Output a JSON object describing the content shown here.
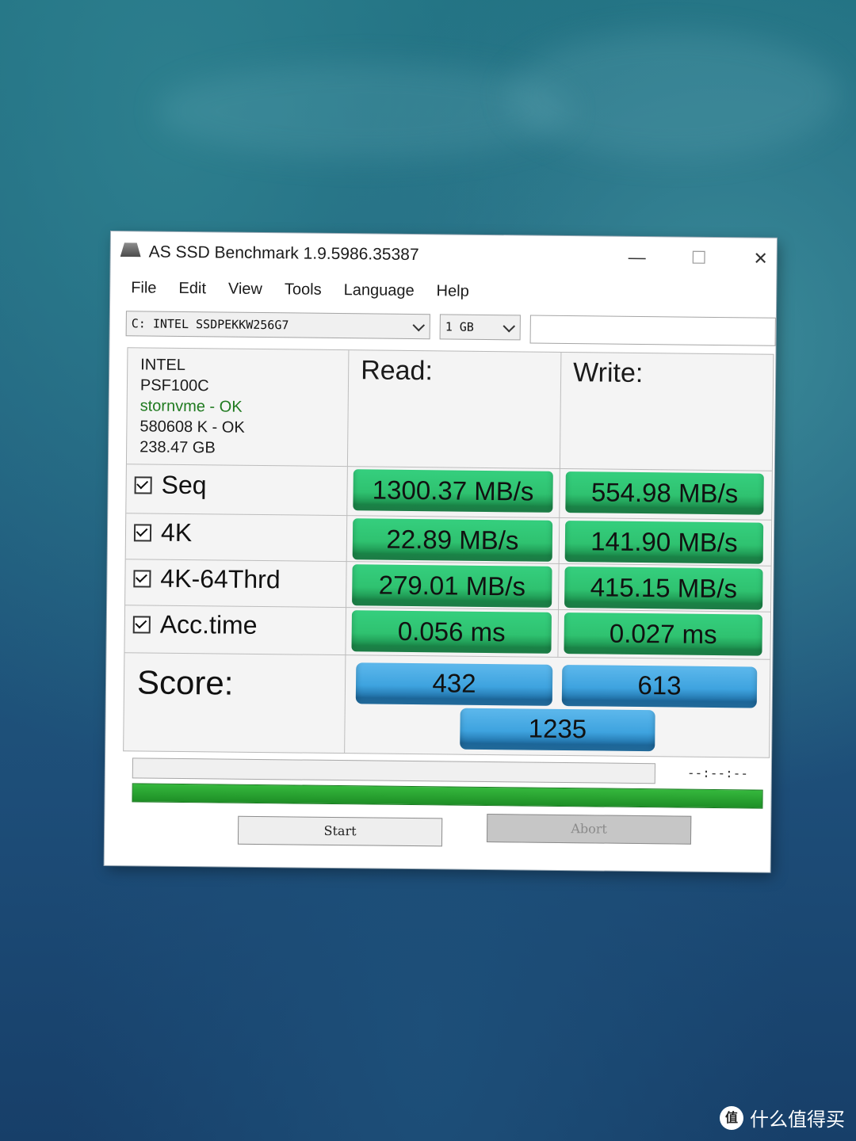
{
  "window": {
    "title": "AS SSD Benchmark 1.9.5986.35387",
    "minimize_glyph": "—",
    "maximize_glyph": "☐",
    "close_glyph": "✕"
  },
  "menu": [
    "File",
    "Edit",
    "View",
    "Tools",
    "Language",
    "Help"
  ],
  "drive_select": {
    "value": "C: INTEL SSDPEKKW256G7"
  },
  "size_select": {
    "value": "1 GB"
  },
  "drive_info": {
    "vendor": "INTEL",
    "firmware": "PSF100C",
    "driver": "stornvme - OK",
    "alignment": "580608 K - OK",
    "capacity": "238.47 GB"
  },
  "columns": {
    "read": "Read:",
    "write": "Write:"
  },
  "rows": [
    {
      "label": "Seq",
      "read": "1300.37 MB/s",
      "write": "554.98 MB/s"
    },
    {
      "label": "4K",
      "read": "22.89 MB/s",
      "write": "141.90 MB/s"
    },
    {
      "label": "4K-64Thrd",
      "read": "279.01 MB/s",
      "write": "415.15 MB/s"
    },
    {
      "label": "Acc.time",
      "read": "0.056 ms",
      "write": "0.027 ms"
    }
  ],
  "score": {
    "label": "Score:",
    "read": "432",
    "write": "613",
    "total": "1235"
  },
  "progress": {
    "time": "--:--:--",
    "bar_fill": 1.0
  },
  "buttons": {
    "start": "Start",
    "abort": "Abort"
  },
  "watermark": {
    "badge": "值",
    "text": "什么值得买"
  },
  "colors": {
    "result_green": "#2fc270",
    "score_blue": "#3ea3df",
    "progress_green": "#2aa832"
  }
}
